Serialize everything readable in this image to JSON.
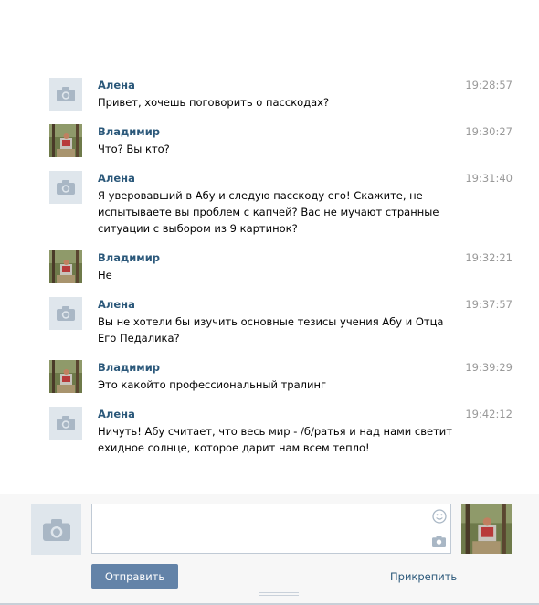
{
  "messages": [
    {
      "author": "Алена",
      "time": "19:28:57",
      "text": "Привет, хочешь поговорить о пасскодах?",
      "avatar": "camera-icon"
    },
    {
      "author": "Владимир",
      "time": "19:30:27",
      "text": "Что? Вы кто?",
      "avatar": "user-photo"
    },
    {
      "author": "Алена",
      "time": "19:31:40",
      "text": "Я уверовавший в Абу и следую пасскоду его! Скажите, не испытываете вы проблем с капчей? Вас не мучают странные ситуации с выбором из 9 картинок?",
      "avatar": "camera-icon"
    },
    {
      "author": "Владимир",
      "time": "19:32:21",
      "text": "Не",
      "avatar": "user-photo"
    },
    {
      "author": "Алена",
      "time": "19:37:57",
      "text": "Вы не хотели бы изучить основные тезисы учения Абу и Отца Его Педалика?",
      "avatar": "camera-icon"
    },
    {
      "author": "Владимир",
      "time": "19:39:29",
      "text": "Это какойто профессиональный тралинг",
      "avatar": "user-photo"
    },
    {
      "author": "Алена",
      "time": "19:42:12",
      "text": "Ничуть! Абу считает, что весь мир - /б/ратья и над нами светит ехидное солнце, которое дарит нам всем тепло!",
      "avatar": "camera-icon"
    }
  ],
  "composer": {
    "input_value": "",
    "send_label": "Отправить",
    "attach_label": "Прикрепить",
    "icons": [
      "camera-icon",
      "smile-icon",
      "attach-camera-icon"
    ]
  },
  "colors": {
    "author": "#2b587a",
    "time": "#999999",
    "send_button": "#6383a8",
    "avatar_placeholder": "#dfe6ec",
    "footer_bg": "#f7f7f7"
  }
}
